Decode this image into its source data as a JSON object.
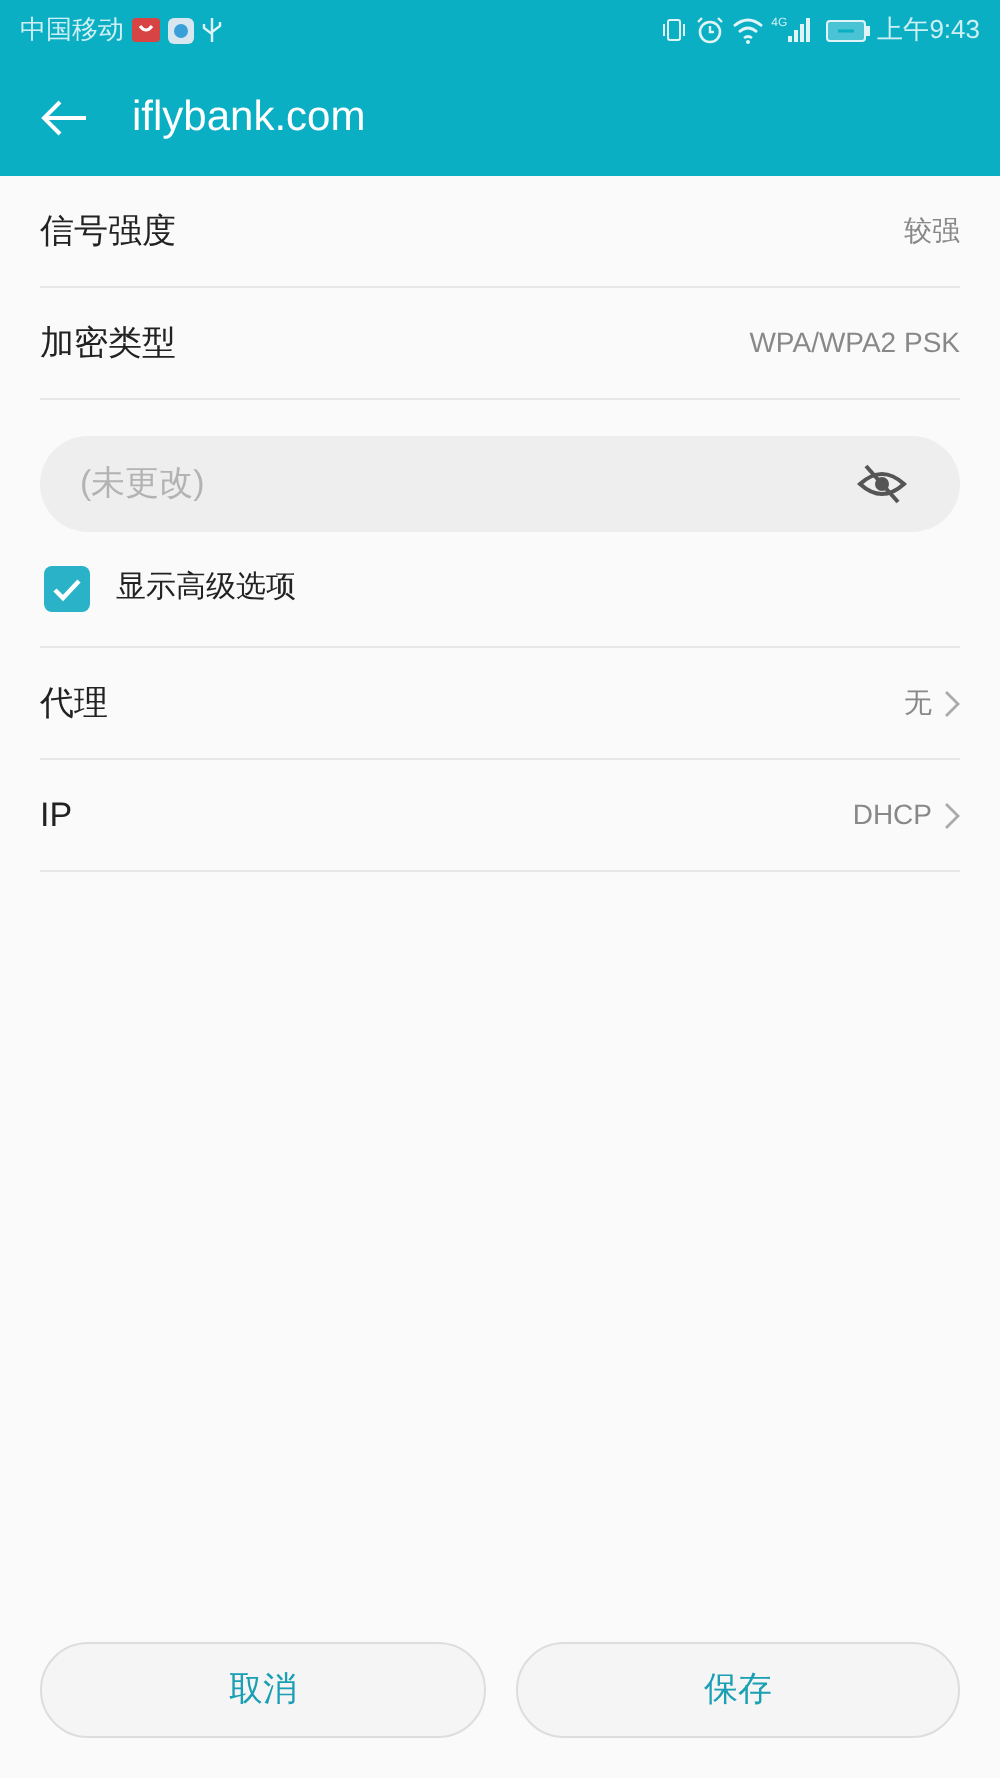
{
  "status_bar": {
    "carrier": "中国移动",
    "network": "4G",
    "time": "上午9:43"
  },
  "app_bar": {
    "title": "iflybank.com"
  },
  "info_rows": [
    {
      "label": "信号强度",
      "value": "较强"
    },
    {
      "label": "加密类型",
      "value": "WPA/WPA2 PSK"
    }
  ],
  "password": {
    "placeholder": "(未更改)"
  },
  "advanced": {
    "label": "显示高级选项",
    "checked": true
  },
  "option_rows": [
    {
      "label": "代理",
      "value": "无"
    },
    {
      "label": "IP",
      "value": "DHCP"
    }
  ],
  "buttons": [
    "取消",
    "保存"
  ]
}
